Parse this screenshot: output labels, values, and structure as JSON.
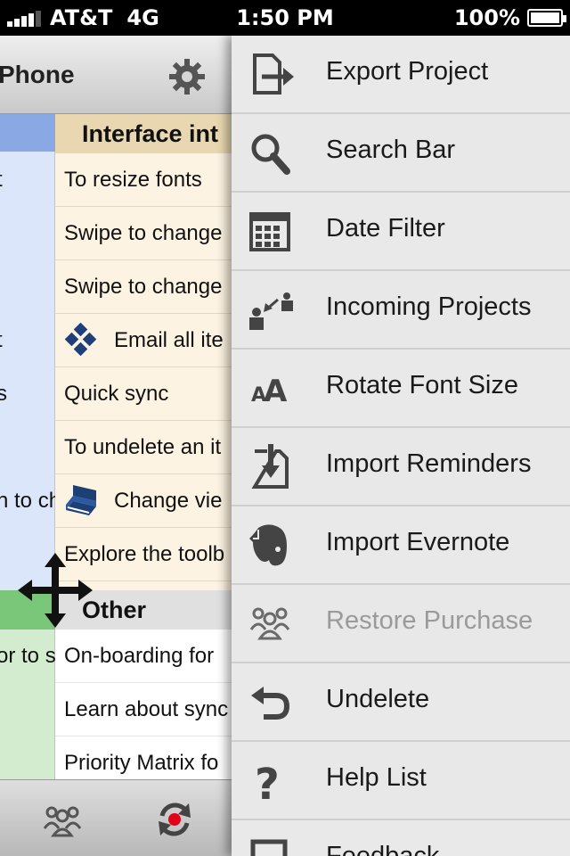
{
  "status_bar": {
    "carrier": "AT&T",
    "network": "4G",
    "time": "1:50 PM",
    "battery": "100%"
  },
  "app": {
    "title": "Phone",
    "quadrant1": {
      "header": "Interface int",
      "color": "#e8d7b0",
      "tasks": [
        {
          "label": "To resize fonts"
        },
        {
          "label": "Swipe to change"
        },
        {
          "label": "Swipe to change"
        },
        {
          "label": "Email all ite",
          "icon": "diamond-icon"
        },
        {
          "label": "Quick sync"
        },
        {
          "label": "To undelete an it"
        },
        {
          "label": "Change vie",
          "icon": "book-icon"
        },
        {
          "label": "Explore the toolb"
        }
      ]
    },
    "quadrant2": {
      "header": "Other",
      "tasks": [
        {
          "label": "On-boarding for"
        },
        {
          "label": "Learn about sync"
        },
        {
          "label": "Priority Matrix fo"
        }
      ]
    },
    "left_column_fragments": [
      {
        "text": "t"
      },
      {
        "text": "t"
      },
      {
        "text": "s"
      },
      {
        "text": "n to ch"
      },
      {
        "text": "or to s"
      }
    ],
    "toolbar": {
      "people_icon": "people-icon",
      "sync_icon": "sync-icon"
    }
  },
  "menu": {
    "items": [
      {
        "label": "Export Project",
        "icon": "export-icon",
        "enabled": true
      },
      {
        "label": "Search Bar",
        "icon": "search-icon",
        "enabled": true
      },
      {
        "label": "Date Filter",
        "icon": "calendar-icon",
        "enabled": true
      },
      {
        "label": "Incoming Projects",
        "icon": "incoming-icon",
        "enabled": true
      },
      {
        "label": "Rotate Font Size",
        "icon": "font-size-icon",
        "enabled": true
      },
      {
        "label": "Import Reminders",
        "icon": "import-icon",
        "enabled": true
      },
      {
        "label": "Import Evernote",
        "icon": "evernote-icon",
        "enabled": true
      },
      {
        "label": "Restore Purchase",
        "icon": "people-icon",
        "enabled": false
      },
      {
        "label": "Undelete",
        "icon": "undo-icon",
        "enabled": true
      },
      {
        "label": "Help List",
        "icon": "question-icon",
        "enabled": true
      },
      {
        "label": "Feedback",
        "icon": "feedback-icon",
        "enabled": true
      }
    ]
  }
}
